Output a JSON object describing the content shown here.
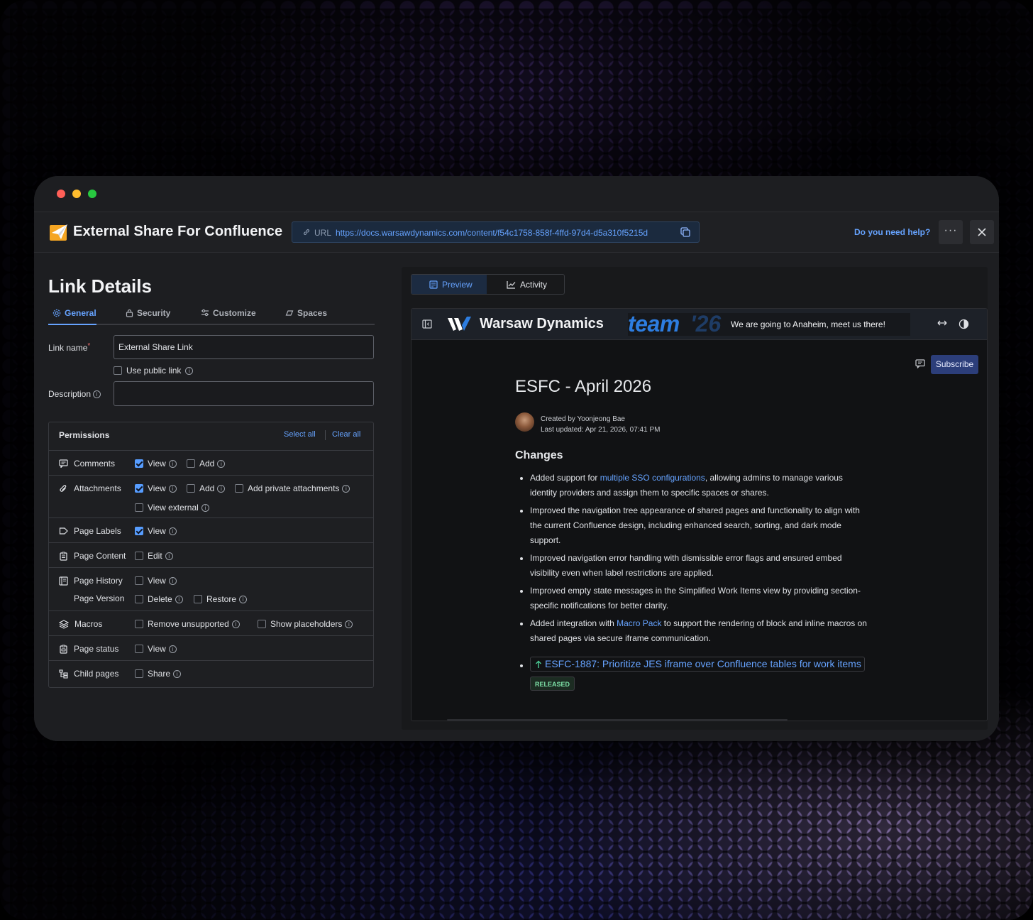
{
  "app": {
    "title": "External Share For Confluence",
    "url_label": "URL",
    "url": "https://docs.warsawdynamics.com/content/f54c1758-858f-4ffd-97d4-d5a310f5215d",
    "help_link": "Do you need help?",
    "more_label": "···"
  },
  "link_details": {
    "title": "Link Details",
    "tabs": [
      {
        "label": "General",
        "icon": "gear-icon",
        "active": true
      },
      {
        "label": "Security",
        "icon": "lock-icon"
      },
      {
        "label": "Customize",
        "icon": "sliders-icon"
      },
      {
        "label": "Spaces",
        "icon": "spaces-icon"
      }
    ],
    "link_name_label": "Link name",
    "required_mark": "*",
    "link_name_value": "External Share Link",
    "use_public_link": "Use public link",
    "description_label": "Description",
    "description_value": ""
  },
  "permissions": {
    "title": "Permissions",
    "select_all": "Select all",
    "clear_all": "Clear all",
    "rows": {
      "comments": {
        "name": "Comments",
        "view": "View",
        "add": "Add"
      },
      "attachments": {
        "name": "Attachments",
        "view": "View",
        "add": "Add",
        "add_private": "Add private attachments",
        "view_external": "View external"
      },
      "page_labels": {
        "name": "Page Labels",
        "view": "View"
      },
      "page_content": {
        "name": "Page Content",
        "edit": "Edit"
      },
      "page_history": {
        "name": "Page History",
        "sub_name": "Page Version",
        "view": "View",
        "delete": "Delete",
        "restore": "Restore"
      },
      "macros": {
        "name": "Macros",
        "remove_unsupported": "Remove unsupported",
        "show_placeholders": "Show placeholders"
      },
      "page_status": {
        "name": "Page status",
        "view": "View"
      },
      "child_pages": {
        "name": "Child pages",
        "share": "Share"
      }
    },
    "checked": {
      "comments_view": true,
      "attachments_view": true,
      "page_labels_view": true
    }
  },
  "preview": {
    "tabs": [
      {
        "label": "Preview",
        "icon": "document-icon",
        "active": true
      },
      {
        "label": "Activity",
        "icon": "chart-line-icon"
      }
    ],
    "site_name": "Warsaw Dynamics",
    "banner_word": "team",
    "banner_year": "'26",
    "banner_text": "We are going to Anaheim, meet us there!",
    "subscribe": "Subscribe",
    "doc_title": "ESFC - April 2026",
    "created_by": "Created by Yoonjeong Bae",
    "last_updated": "Last updated: Apr 21, 2026, 07:41 PM",
    "section_heading": "Changes",
    "items": [
      {
        "pre": "Added support for ",
        "link": "multiple SSO configurations",
        "post": ", allowing admins to manage various identity providers and assign them to specific spaces or shares."
      },
      {
        "pre": "Improved the navigation tree appearance of shared pages and functionality to align with the current Confluence design, including enhanced search, sorting, and dark mode support.",
        "link": "",
        "post": ""
      },
      {
        "pre": "Improved navigation error handling with dismissible error flags and ensured embed visibility even when label restrictions are applied.",
        "link": "",
        "post": ""
      },
      {
        "pre": "Improved empty state messages in the Simplified Work Items view by providing section-specific notifications for better clarity.",
        "link": "",
        "post": ""
      },
      {
        "pre": "Added integration with ",
        "link": "Macro Pack",
        "post": " to support the rendering of block and inline macros on shared pages via secure iframe communication."
      }
    ],
    "jira_issue": "ESFC-1887: Prioritize JES iframe over Confluence tables for work items",
    "jira_status": "RELEASED"
  },
  "colors": {
    "accent": "#66a3ff",
    "window_bg": "#1d1e21",
    "subscribe_bg": "#2c3e7a",
    "released_fg": "#7ee2a8"
  }
}
